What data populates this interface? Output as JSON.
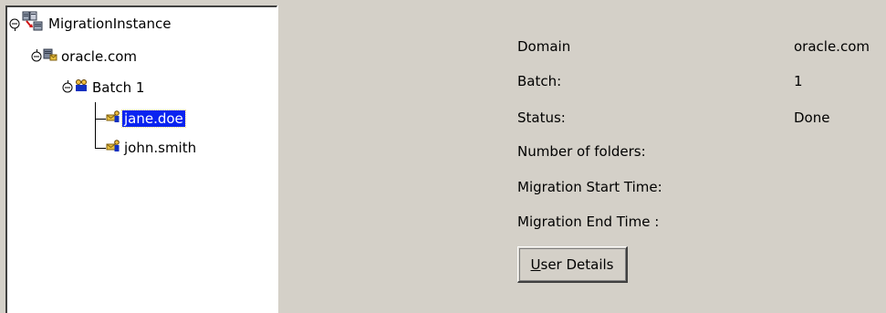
{
  "tree": {
    "nodes": [
      {
        "label": "MigrationInstance",
        "icon": "migration-instance-icon",
        "expanded": true
      },
      {
        "label": "oracle.com",
        "icon": "domain-server-icon",
        "expanded": true
      },
      {
        "label": "Batch 1",
        "icon": "batch-users-icon",
        "expanded": true
      },
      {
        "label": "jane.doe",
        "icon": "mail-user-icon",
        "selected": true
      },
      {
        "label": "john.smith",
        "icon": "mail-user-icon"
      }
    ],
    "selection_color": "#0a24f0"
  },
  "details": {
    "fields": [
      {
        "label": "Domain",
        "value": "oracle.com"
      },
      {
        "label": "Batch:",
        "value": "1"
      },
      {
        "label": "Status:",
        "value": "Done"
      },
      {
        "label": "Number of folders:",
        "value": ""
      },
      {
        "label": "Migration Start Time:",
        "value": ""
      },
      {
        "label": "Migration End Time :",
        "value": ""
      }
    ],
    "button": {
      "mnemonic": "U",
      "rest": "ser Details"
    }
  },
  "colors": {
    "background": "#d4d0c8",
    "tree_background": "#ffffff"
  }
}
